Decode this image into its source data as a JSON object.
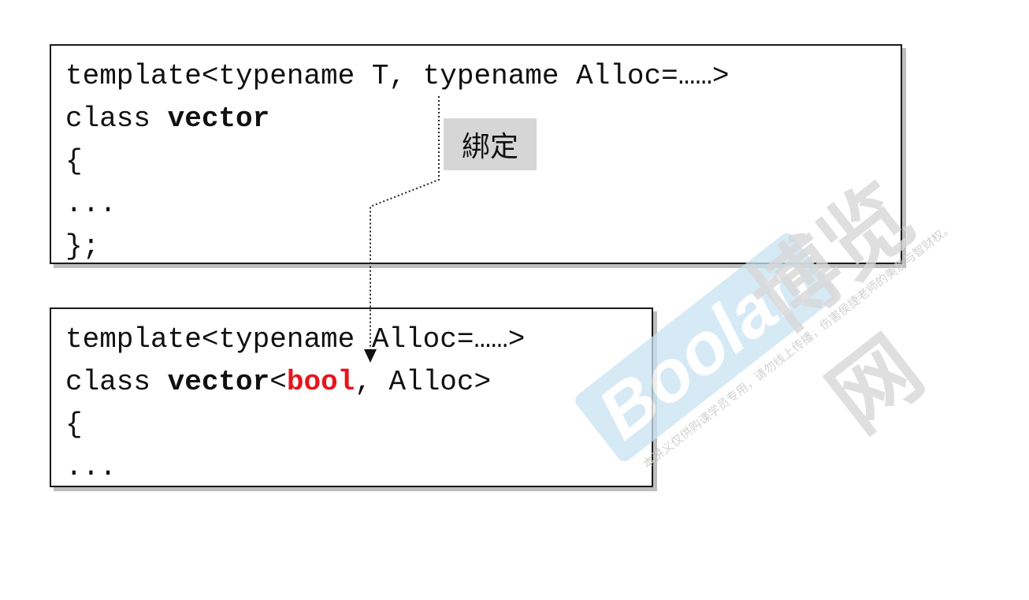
{
  "top_code": {
    "line1": "template<typename T, typename Alloc=……>",
    "line2_prefix": "class ",
    "line2_name": "vector",
    "line3": "{",
    "line4": "...",
    "line5": "};"
  },
  "bottom_code": {
    "line1": "template<typename Alloc=……>",
    "line2_prefix": "class ",
    "line2_name": "vector",
    "line2_open": "<",
    "line2_type": "bool",
    "line2_rest": ", Alloc>",
    "line3": "{",
    "line4": "..."
  },
  "binding_label": "綁定",
  "watermark": {
    "logo": "Boolan",
    "name": "博览网",
    "note": "本讲义仅供购课学员专用，请勿线上传播，伤害侯捷老师的美意与智财权。"
  },
  "colors": {
    "highlight": "#e8141c",
    "watermark_blue": "#c9e3f3"
  }
}
